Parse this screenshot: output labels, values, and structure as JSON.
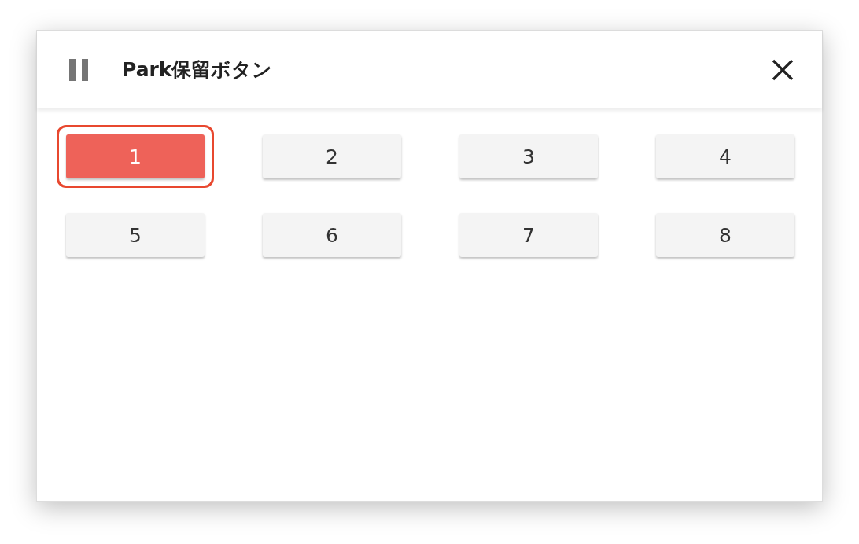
{
  "dialog": {
    "title": "Park保留ボタン"
  },
  "buttons": [
    {
      "label": "1",
      "selected": true,
      "outlined": true
    },
    {
      "label": "2",
      "selected": false,
      "outlined": false
    },
    {
      "label": "3",
      "selected": false,
      "outlined": false
    },
    {
      "label": "4",
      "selected": false,
      "outlined": false
    },
    {
      "label": "5",
      "selected": false,
      "outlined": false
    },
    {
      "label": "6",
      "selected": false,
      "outlined": false
    },
    {
      "label": "7",
      "selected": false,
      "outlined": false
    },
    {
      "label": "8",
      "selected": false,
      "outlined": false
    }
  ]
}
